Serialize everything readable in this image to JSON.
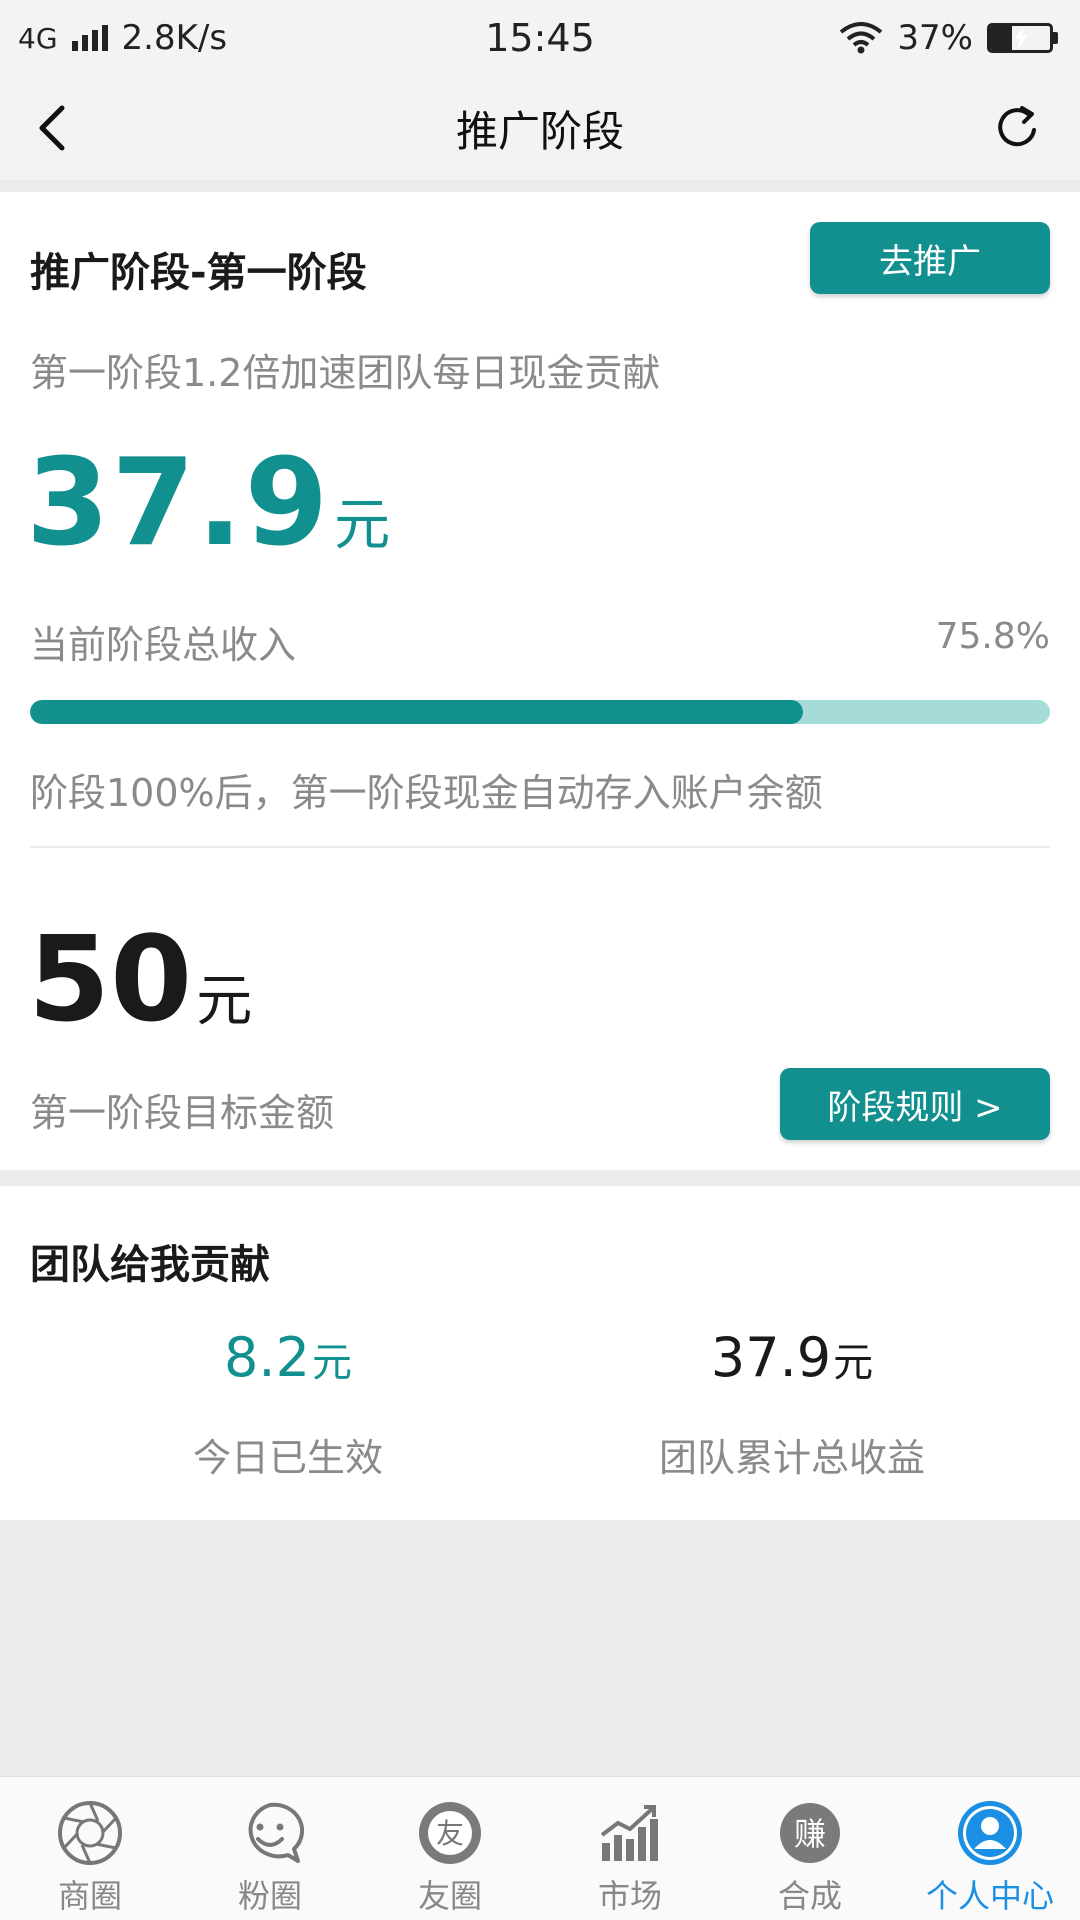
{
  "status_bar": {
    "network": "4G",
    "speed": "2.8K/s",
    "time": "15:45",
    "battery": "37%",
    "battery_level": 0.37
  },
  "nav": {
    "title": "推广阶段"
  },
  "stage": {
    "title": "推广阶段-第一阶段",
    "promote_button": "去推广",
    "description": "第一阶段1.2倍加速团队每日现金贡献",
    "current_amount": "37.9",
    "unit": "元",
    "income_label": "当前阶段总收入",
    "progress_percent": "75.8%",
    "progress_value": 0.758,
    "progress_note": "阶段100%后，第一阶段现金自动存入账户余额",
    "target_amount": "50",
    "target_label": "第一阶段目标金额",
    "rules_button": "阶段规则 >"
  },
  "team": {
    "title": "团队给我贡献",
    "today_value": "8.2",
    "today_label": "今日已生效",
    "total_value": "37.9",
    "total_label": "团队累计总收益",
    "unit": "元"
  },
  "tabs": [
    {
      "label": "商圈",
      "icon": "aperture-icon",
      "active": false
    },
    {
      "label": "粉圈",
      "icon": "smile-chat-icon",
      "active": false
    },
    {
      "label": "友圈",
      "icon": "friend-circle-icon",
      "icon_text": "友",
      "active": false
    },
    {
      "label": "市场",
      "icon": "chart-trend-icon",
      "active": false
    },
    {
      "label": "合成",
      "icon": "earn-icon",
      "icon_text": "赚",
      "active": false
    },
    {
      "label": "个人中心",
      "icon": "user-icon",
      "active": true
    }
  ],
  "colors": {
    "accent": "#12908f",
    "progress_track": "#a5dcda",
    "active_tab": "#1a8fe3"
  }
}
